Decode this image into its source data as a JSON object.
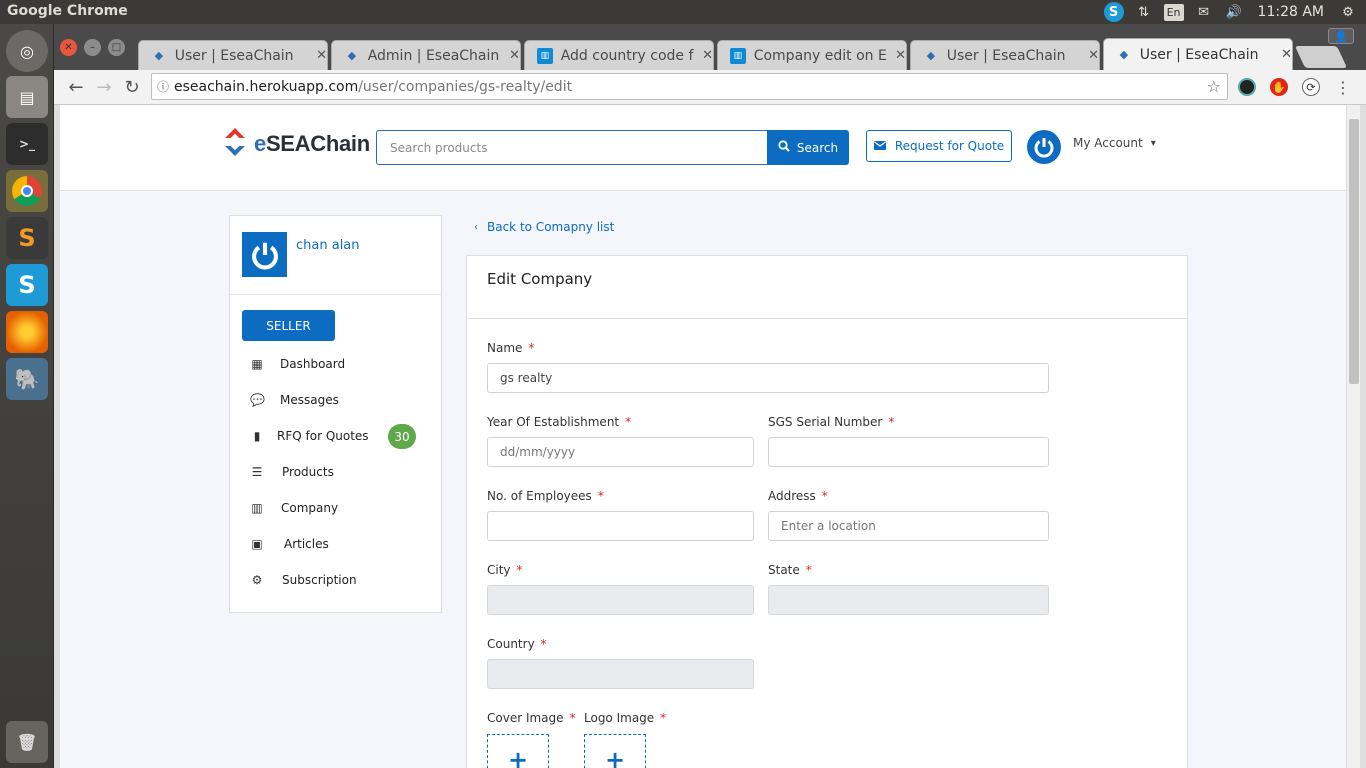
{
  "os": {
    "app_title": "Google Chrome",
    "time": "11:28 AM",
    "keyboard_layout": "En"
  },
  "launcher": [
    "ubuntu-dash",
    "files",
    "terminal",
    "chrome",
    "sublime-text",
    "skype",
    "firefox",
    "postgres",
    "trash"
  ],
  "browser": {
    "tabs": [
      {
        "label": "User | EseaChain",
        "favicon": "esea-icon"
      },
      {
        "label": "Admin | EseaChain",
        "favicon": "esea-icon"
      },
      {
        "label": "Add country code f",
        "favicon": "trello-icon"
      },
      {
        "label": "Company edit on E",
        "favicon": "trello-icon"
      },
      {
        "label": "User | EseaChain",
        "favicon": "esea-icon"
      },
      {
        "label": "User | EseaChain",
        "favicon": "esea-icon",
        "active": true
      }
    ],
    "url_host": "eseachain.herokuapp.com",
    "url_path": "/user/companies/gs-realty/edit"
  },
  "header": {
    "logo_prefix": "e",
    "logo_brand": "SEAChain",
    "search_placeholder": "Search products",
    "search_label": "Search",
    "rfq_label": "Request for Quote",
    "account_label": "My Account"
  },
  "sidebar": {
    "username": "chan alan",
    "role_label": "SELLER",
    "items": [
      {
        "label": "Dashboard",
        "icon": "th-large-icon"
      },
      {
        "label": "Messages",
        "icon": "comment-icon"
      },
      {
        "label": "RFQ for Quotes",
        "icon": "file-icon",
        "badge": "30"
      },
      {
        "label": "Products",
        "icon": "list-icon"
      },
      {
        "label": "Company",
        "icon": "building-icon"
      },
      {
        "label": "Articles",
        "icon": "id-card-icon"
      },
      {
        "label": "Subscription",
        "icon": "gear-icon"
      }
    ]
  },
  "main": {
    "back_link": "Back to Comapny list",
    "card_title": "Edit Company",
    "required_mark": "*",
    "fields": {
      "name": {
        "label": "Name",
        "value": "gs realty"
      },
      "year": {
        "label": "Year Of Establishment",
        "placeholder": "dd/mm/yyyy"
      },
      "sgs": {
        "label": "SGS Serial Number",
        "value": ""
      },
      "employees": {
        "label": "No. of Employees",
        "value": ""
      },
      "address": {
        "label": "Address",
        "placeholder": "Enter a location"
      },
      "city": {
        "label": "City",
        "value": ""
      },
      "state": {
        "label": "State",
        "value": ""
      },
      "country": {
        "label": "Country",
        "value": ""
      },
      "cover": {
        "label": "Cover Image"
      },
      "logo": {
        "label": "Logo Image"
      }
    }
  },
  "colors": {
    "brand_blue": "#0c6cc2",
    "logo_red": "#e2372e",
    "required_red": "#e0261b",
    "badge_green": "#5fa94b"
  }
}
